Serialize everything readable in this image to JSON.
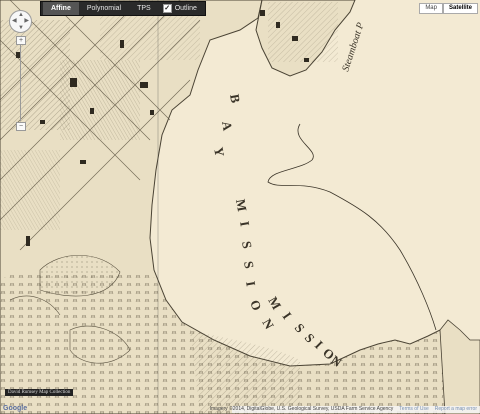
{
  "toolbar": {
    "buttons": [
      {
        "label": "Affine",
        "active": true
      },
      {
        "label": "Polynomial",
        "active": false
      },
      {
        "label": "TPS",
        "active": false
      }
    ],
    "outline_label": "Outline",
    "outline_checked": true
  },
  "map_type": {
    "buttons": [
      {
        "label": "Map",
        "selected": false
      },
      {
        "label": "Satellite",
        "selected": true
      }
    ]
  },
  "map_labels": {
    "bay_letters_upper": [
      "B",
      "A",
      "Y"
    ],
    "bay_letters_lower": [
      "M",
      "I",
      "S",
      "S",
      "I",
      "O",
      "N"
    ],
    "lower_letters_continued": [
      "M",
      "I",
      "S",
      "S",
      "I",
      "O",
      "N"
    ],
    "road_label": "Steamboat P"
  },
  "controls": {
    "zoom_in": "+",
    "zoom_out": "−",
    "pan_up": "▲",
    "pan_down": "▼",
    "pan_left": "◀",
    "pan_right": "▶"
  },
  "collection_badge": "David Rumsey Map Collection",
  "attribution": {
    "text": "Imagery ©2014, DigitalGlobe, U.S. Geological Survey, USDA Farm Service Agency",
    "terms": "Terms of Use",
    "report": "Report a map error"
  },
  "logo_text": "Google",
  "colors": {
    "paper": "#f3ead3",
    "land": "#e9dfc4",
    "ink": "#3a3428",
    "toolbar": "#2a2a2a"
  }
}
